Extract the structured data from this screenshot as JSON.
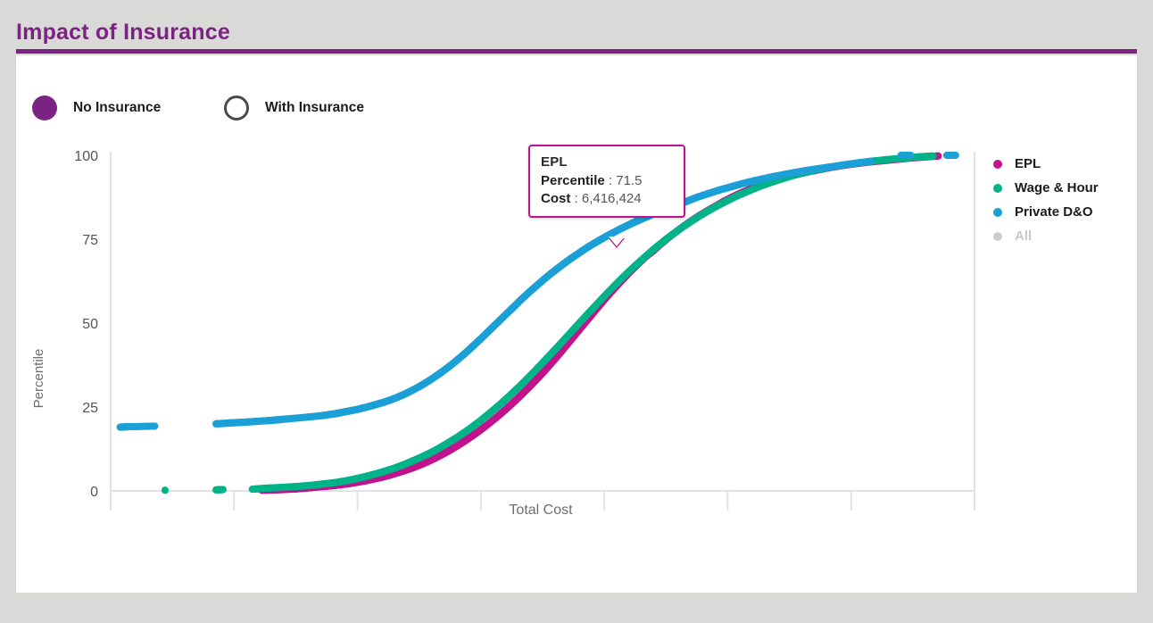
{
  "header": {
    "title": "Impact of Insurance",
    "accent_color": "#7b2382"
  },
  "insurance_toggle": {
    "options": [
      {
        "label": "No Insurance",
        "selected": true
      },
      {
        "label": "With Insurance",
        "selected": false
      }
    ]
  },
  "tooltip": {
    "title": "EPL",
    "percentile_label": "Percentile",
    "percentile_value": "71.5",
    "cost_label": "Cost",
    "cost_value": "6,416,424",
    "separator": ":",
    "border_color": "#c2128d"
  },
  "legend": {
    "items": [
      {
        "label": "EPL",
        "color": "#c2128d",
        "enabled": true
      },
      {
        "label": "Wage & Hour",
        "color": "#00b388",
        "enabled": true
      },
      {
        "label": "Private D&O",
        "color": "#1ba0d7",
        "enabled": true
      },
      {
        "label": "All",
        "color": "#cccccc",
        "enabled": false
      }
    ]
  },
  "chart_data": {
    "type": "scatter",
    "title": "Impact of Insurance",
    "xlabel": "Total Cost",
    "ylabel": "Percentile",
    "ylim": [
      0,
      100
    ],
    "yticks": [
      0,
      25,
      50,
      75,
      100
    ],
    "ytick_labels": [
      "0",
      "25",
      "50",
      "75",
      "100"
    ],
    "xticks": [
      0,
      1,
      2,
      3,
      4,
      5,
      6,
      7
    ],
    "xtick_labels": [
      "",
      "",
      "",
      "",
      "",
      "",
      "",
      ""
    ],
    "grid": false,
    "legend_position": "right",
    "xlim": [
      0,
      100
    ],
    "series": [
      {
        "name": "EPL",
        "color": "#c2128d",
        "x": [
          17.5,
          19.2,
          20.6,
          21.5,
          22.4,
          23.2,
          24.1,
          25.0,
          25.9,
          26.8,
          27.7,
          28.6,
          29.5,
          30.4,
          31.3,
          32.2,
          33.1,
          34.0,
          34.9,
          35.8,
          36.7,
          37.6,
          38.5,
          39.4,
          40.3,
          41.2,
          42.1,
          43.0,
          43.9,
          44.8,
          45.7,
          46.6,
          47.5,
          48.4,
          49.3,
          50.2,
          51.1,
          52.0,
          52.9,
          53.8,
          54.7,
          55.6,
          56.5,
          57.4,
          58.3,
          59.2,
          60.1,
          61.0,
          61.9,
          62.8,
          63.7,
          64.6,
          65.5,
          66.4,
          67.3,
          68.2,
          69.1,
          70.0,
          71.0,
          72.0,
          73.0,
          74.0,
          75.0,
          76.0,
          77.2,
          78.4,
          79.6,
          80.8,
          82.0,
          83.4,
          84.8,
          86.2,
          87.8,
          89.4,
          91.0,
          92.6,
          94.2,
          95.8
        ],
        "y": [
          0.2,
          0.3,
          0.5,
          0.6,
          0.8,
          1.0,
          1.2,
          1.4,
          1.6,
          1.9,
          2.2,
          2.6,
          3.0,
          3.5,
          4.0,
          4.6,
          5.3,
          6.0,
          6.8,
          7.7,
          8.7,
          9.8,
          11.0,
          12.3,
          13.7,
          15.2,
          16.8,
          18.5,
          20.3,
          22.2,
          24.2,
          26.3,
          28.5,
          30.8,
          33.2,
          35.7,
          38.3,
          41.0,
          43.8,
          46.6,
          49.4,
          52.2,
          55.0,
          57.7,
          60.3,
          62.8,
          65.2,
          67.5,
          69.7,
          71.5,
          73.6,
          75.5,
          77.3,
          79.0,
          80.6,
          82.1,
          83.5,
          84.8,
          86.3,
          87.6,
          88.8,
          89.9,
          90.9,
          91.8,
          92.8,
          93.7,
          94.4,
          95.1,
          95.7,
          96.4,
          97.0,
          97.5,
          98.0,
          98.4,
          98.8,
          99.2,
          99.5,
          99.8
        ]
      },
      {
        "name": "Wage & Hour",
        "color": "#00b388",
        "x": [
          6.3,
          12.2,
          13.0,
          16.4,
          18.0,
          19.6,
          21.5,
          23.0,
          24.4,
          25.8,
          27.0,
          28.2,
          29.4,
          30.6,
          31.8,
          33.0,
          34.2,
          35.4,
          36.6,
          37.8,
          39.0,
          40.2,
          41.4,
          42.6,
          43.8,
          45.0,
          46.2,
          47.4,
          48.6,
          49.8,
          51.0,
          52.2,
          53.4,
          54.6,
          55.8,
          57.0,
          58.2,
          59.4,
          60.6,
          61.8,
          63.0,
          64.2,
          65.4,
          66.6,
          67.8,
          69.0,
          70.2,
          71.4,
          72.6,
          73.8,
          75.0,
          76.2,
          77.6,
          79.0,
          80.4,
          81.8,
          83.2,
          84.8,
          86.4,
          88.0,
          89.8,
          91.6,
          93.4,
          95.2
        ],
        "y": [
          0.2,
          0.3,
          0.4,
          0.5,
          0.8,
          1.0,
          1.3,
          1.6,
          2.0,
          2.4,
          2.9,
          3.5,
          4.2,
          5.0,
          5.9,
          6.9,
          8.1,
          9.4,
          10.8,
          12.4,
          14.2,
          16.1,
          18.2,
          20.5,
          23.0,
          25.6,
          28.4,
          31.3,
          34.4,
          37.6,
          40.9,
          44.2,
          47.6,
          51.0,
          54.3,
          57.6,
          60.8,
          63.9,
          66.8,
          69.6,
          72.3,
          74.8,
          77.1,
          79.3,
          81.3,
          83.2,
          84.9,
          86.5,
          88.0,
          89.3,
          90.6,
          91.7,
          92.9,
          94.0,
          94.9,
          95.7,
          96.4,
          97.1,
          97.7,
          98.2,
          98.7,
          99.1,
          99.5,
          99.8
        ]
      },
      {
        "name": "Private D&O",
        "color": "#1ba0d7",
        "x": [
          1.1,
          1.9,
          5.1,
          12.2,
          13.0,
          14.1,
          15.0,
          16.2,
          18.0,
          19.0,
          19.8,
          22.0,
          24.4,
          25.2,
          26.0,
          26.8,
          27.6,
          28.4,
          29.2,
          30.0,
          30.8,
          31.6,
          32.4,
          33.2,
          34.0,
          34.8,
          35.6,
          36.4,
          37.2,
          38.0,
          38.8,
          39.6,
          40.4,
          41.2,
          42.0,
          42.8,
          43.6,
          44.4,
          45.2,
          46.0,
          46.8,
          47.6,
          48.4,
          49.2,
          50.0,
          50.8,
          51.6,
          52.4,
          53.2,
          54.0,
          54.8,
          55.6,
          56.4,
          57.2,
          58.0,
          58.8,
          59.6,
          60.4,
          61.2,
          62.0,
          62.8,
          63.6,
          64.4,
          65.2,
          66.0,
          67.0,
          68.0,
          69.2,
          70.4,
          71.8,
          73.2,
          74.8,
          76.6,
          78.6,
          80.8,
          83.2,
          85.6,
          88.0,
          91.5,
          92.6,
          96.8,
          97.8
        ],
        "y": [
          19.0,
          19.1,
          19.3,
          20.0,
          20.1,
          20.3,
          20.4,
          20.6,
          20.9,
          21.1,
          21.3,
          21.8,
          22.4,
          22.7,
          23.0,
          23.4,
          23.8,
          24.2,
          24.7,
          25.2,
          25.8,
          26.4,
          27.1,
          27.9,
          28.8,
          29.8,
          30.9,
          32.1,
          33.4,
          34.8,
          36.3,
          37.9,
          39.6,
          41.4,
          43.3,
          45.2,
          47.2,
          49.2,
          51.2,
          53.2,
          55.2,
          57.2,
          59.1,
          60.9,
          62.7,
          64.4,
          66.0,
          67.6,
          69.1,
          70.5,
          71.9,
          73.2,
          74.4,
          75.6,
          76.7,
          77.8,
          78.8,
          79.8,
          80.7,
          81.6,
          82.5,
          83.3,
          84.1,
          84.9,
          85.6,
          86.6,
          87.6,
          88.6,
          89.6,
          90.6,
          91.6,
          92.6,
          93.6,
          94.6,
          95.6,
          96.5,
          97.4,
          98.2,
          100.0,
          100.0,
          100.0,
          100.0
        ]
      }
    ]
  }
}
